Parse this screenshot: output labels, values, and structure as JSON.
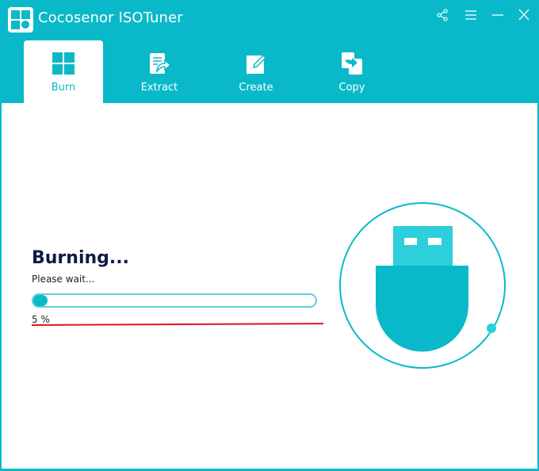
{
  "app": {
    "title": "Cocosenor ISOTuner",
    "logo_icon": "app-logo-icon"
  },
  "window_controls": [
    {
      "name": "share",
      "icon": "share-icon"
    },
    {
      "name": "menu",
      "icon": "hamburger-menu-icon"
    },
    {
      "name": "minimize",
      "icon": "minimize-icon"
    },
    {
      "name": "close",
      "icon": "close-icon"
    }
  ],
  "tabs": [
    {
      "label": "Burn",
      "icon": "grid-icon",
      "active": true
    },
    {
      "label": "Extract",
      "icon": "extract-document-icon",
      "active": false
    },
    {
      "label": "Create",
      "icon": "edit-pencil-icon",
      "active": false
    },
    {
      "label": "Copy",
      "icon": "copy-arrow-icon",
      "active": false
    }
  ],
  "burn": {
    "status_title": "Burning...",
    "status_subtitle": "Please wait...",
    "progress_percent": 5,
    "progress_text": "5 %",
    "illustration": "usb-drive-icon"
  },
  "colors": {
    "accent": "#0ab9c9",
    "accent_light": "#2ecfdc",
    "title_text": "#101a46",
    "underline_red": "#e8101a"
  }
}
